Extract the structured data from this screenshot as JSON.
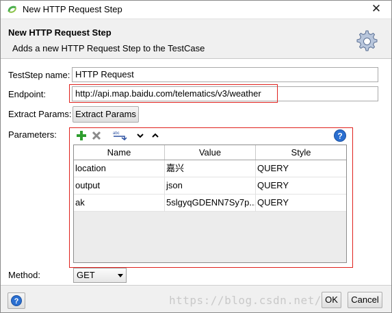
{
  "window": {
    "title": "New HTTP Request Step",
    "close_glyph": "✕"
  },
  "header": {
    "title": "New HTTP Request Step",
    "description": "Adds a new HTTP Request Step to the TestCase"
  },
  "form": {
    "teststep_name_label": "TestStep name:",
    "teststep_name_value": "HTTP Request",
    "endpoint_label": "Endpoint:",
    "endpoint_value": "http://api.map.baidu.com/telematics/v3/weather",
    "extract_params_label": "Extract Params:",
    "extract_params_button": "Extract Params",
    "parameters_label": "Parameters:",
    "method_label": "Method:",
    "method_value": "GET"
  },
  "params_toolbar": {
    "icons": [
      "add-icon",
      "remove-icon",
      "copy-params-icon",
      "move-down-icon",
      "move-up-icon",
      "help-icon"
    ]
  },
  "params_table": {
    "columns": [
      "Name",
      "Value",
      "Style"
    ],
    "rows": [
      {
        "name": "location",
        "value": "嘉兴",
        "style": "QUERY"
      },
      {
        "name": "output",
        "value": "json",
        "style": "QUERY"
      },
      {
        "name": "ak",
        "value": "5slgyqGDENN7Sy7p...",
        "style": "QUERY"
      }
    ]
  },
  "footer": {
    "ok_label": "OK",
    "cancel_label": "Cancel",
    "watermark": "https://blog.csdn.net/"
  },
  "colors": {
    "highlight_border": "#e0201c",
    "add_green": "#2e9e2e",
    "help_blue": "#2a6fd1"
  }
}
